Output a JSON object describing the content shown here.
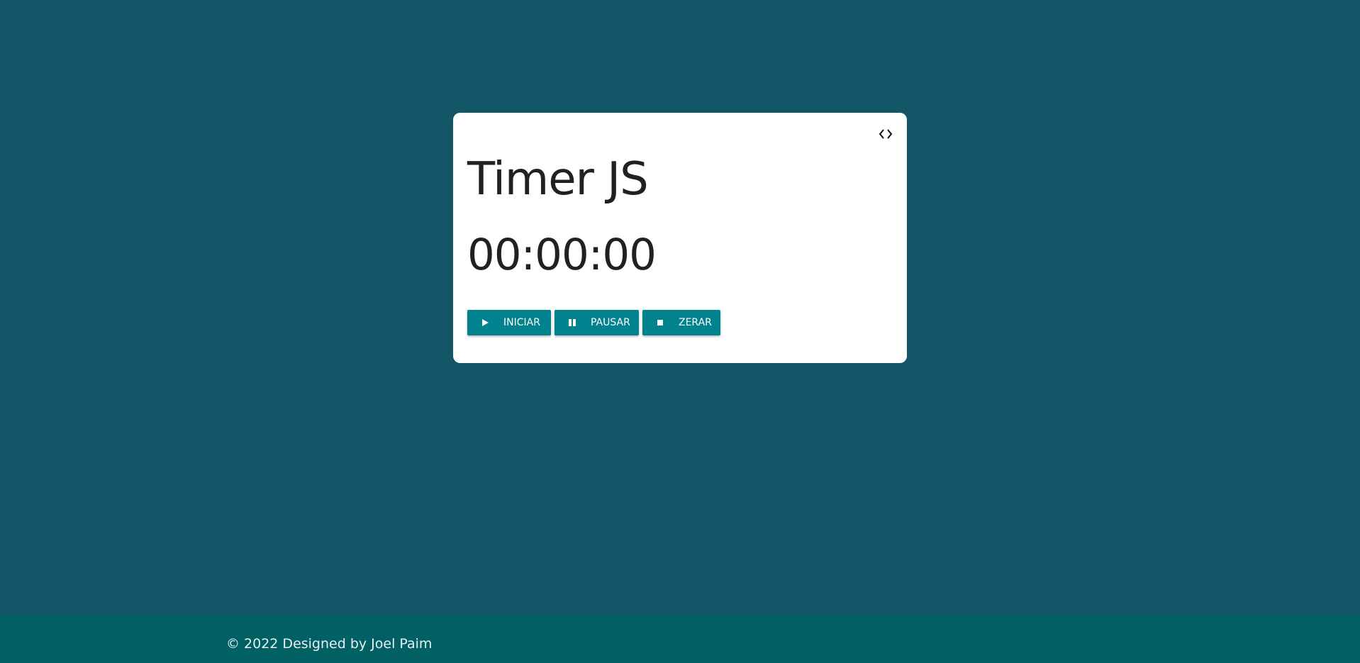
{
  "page": {
    "background_color": "#125668",
    "card_color": "#ffffff",
    "accent_color": "#00838f",
    "footer_color": "#006064"
  },
  "card": {
    "title": "Timer JS",
    "time": "00:00:00",
    "code_icon": "code-icon"
  },
  "controls": {
    "start": {
      "label": "INICIAR",
      "icon": "play-icon"
    },
    "pause": {
      "label": "PAUSAR",
      "icon": "pause-icon"
    },
    "reset": {
      "label": "ZERAR",
      "icon": "stop-icon"
    }
  },
  "footer": {
    "text": "© 2022 Designed by Joel Paim"
  }
}
